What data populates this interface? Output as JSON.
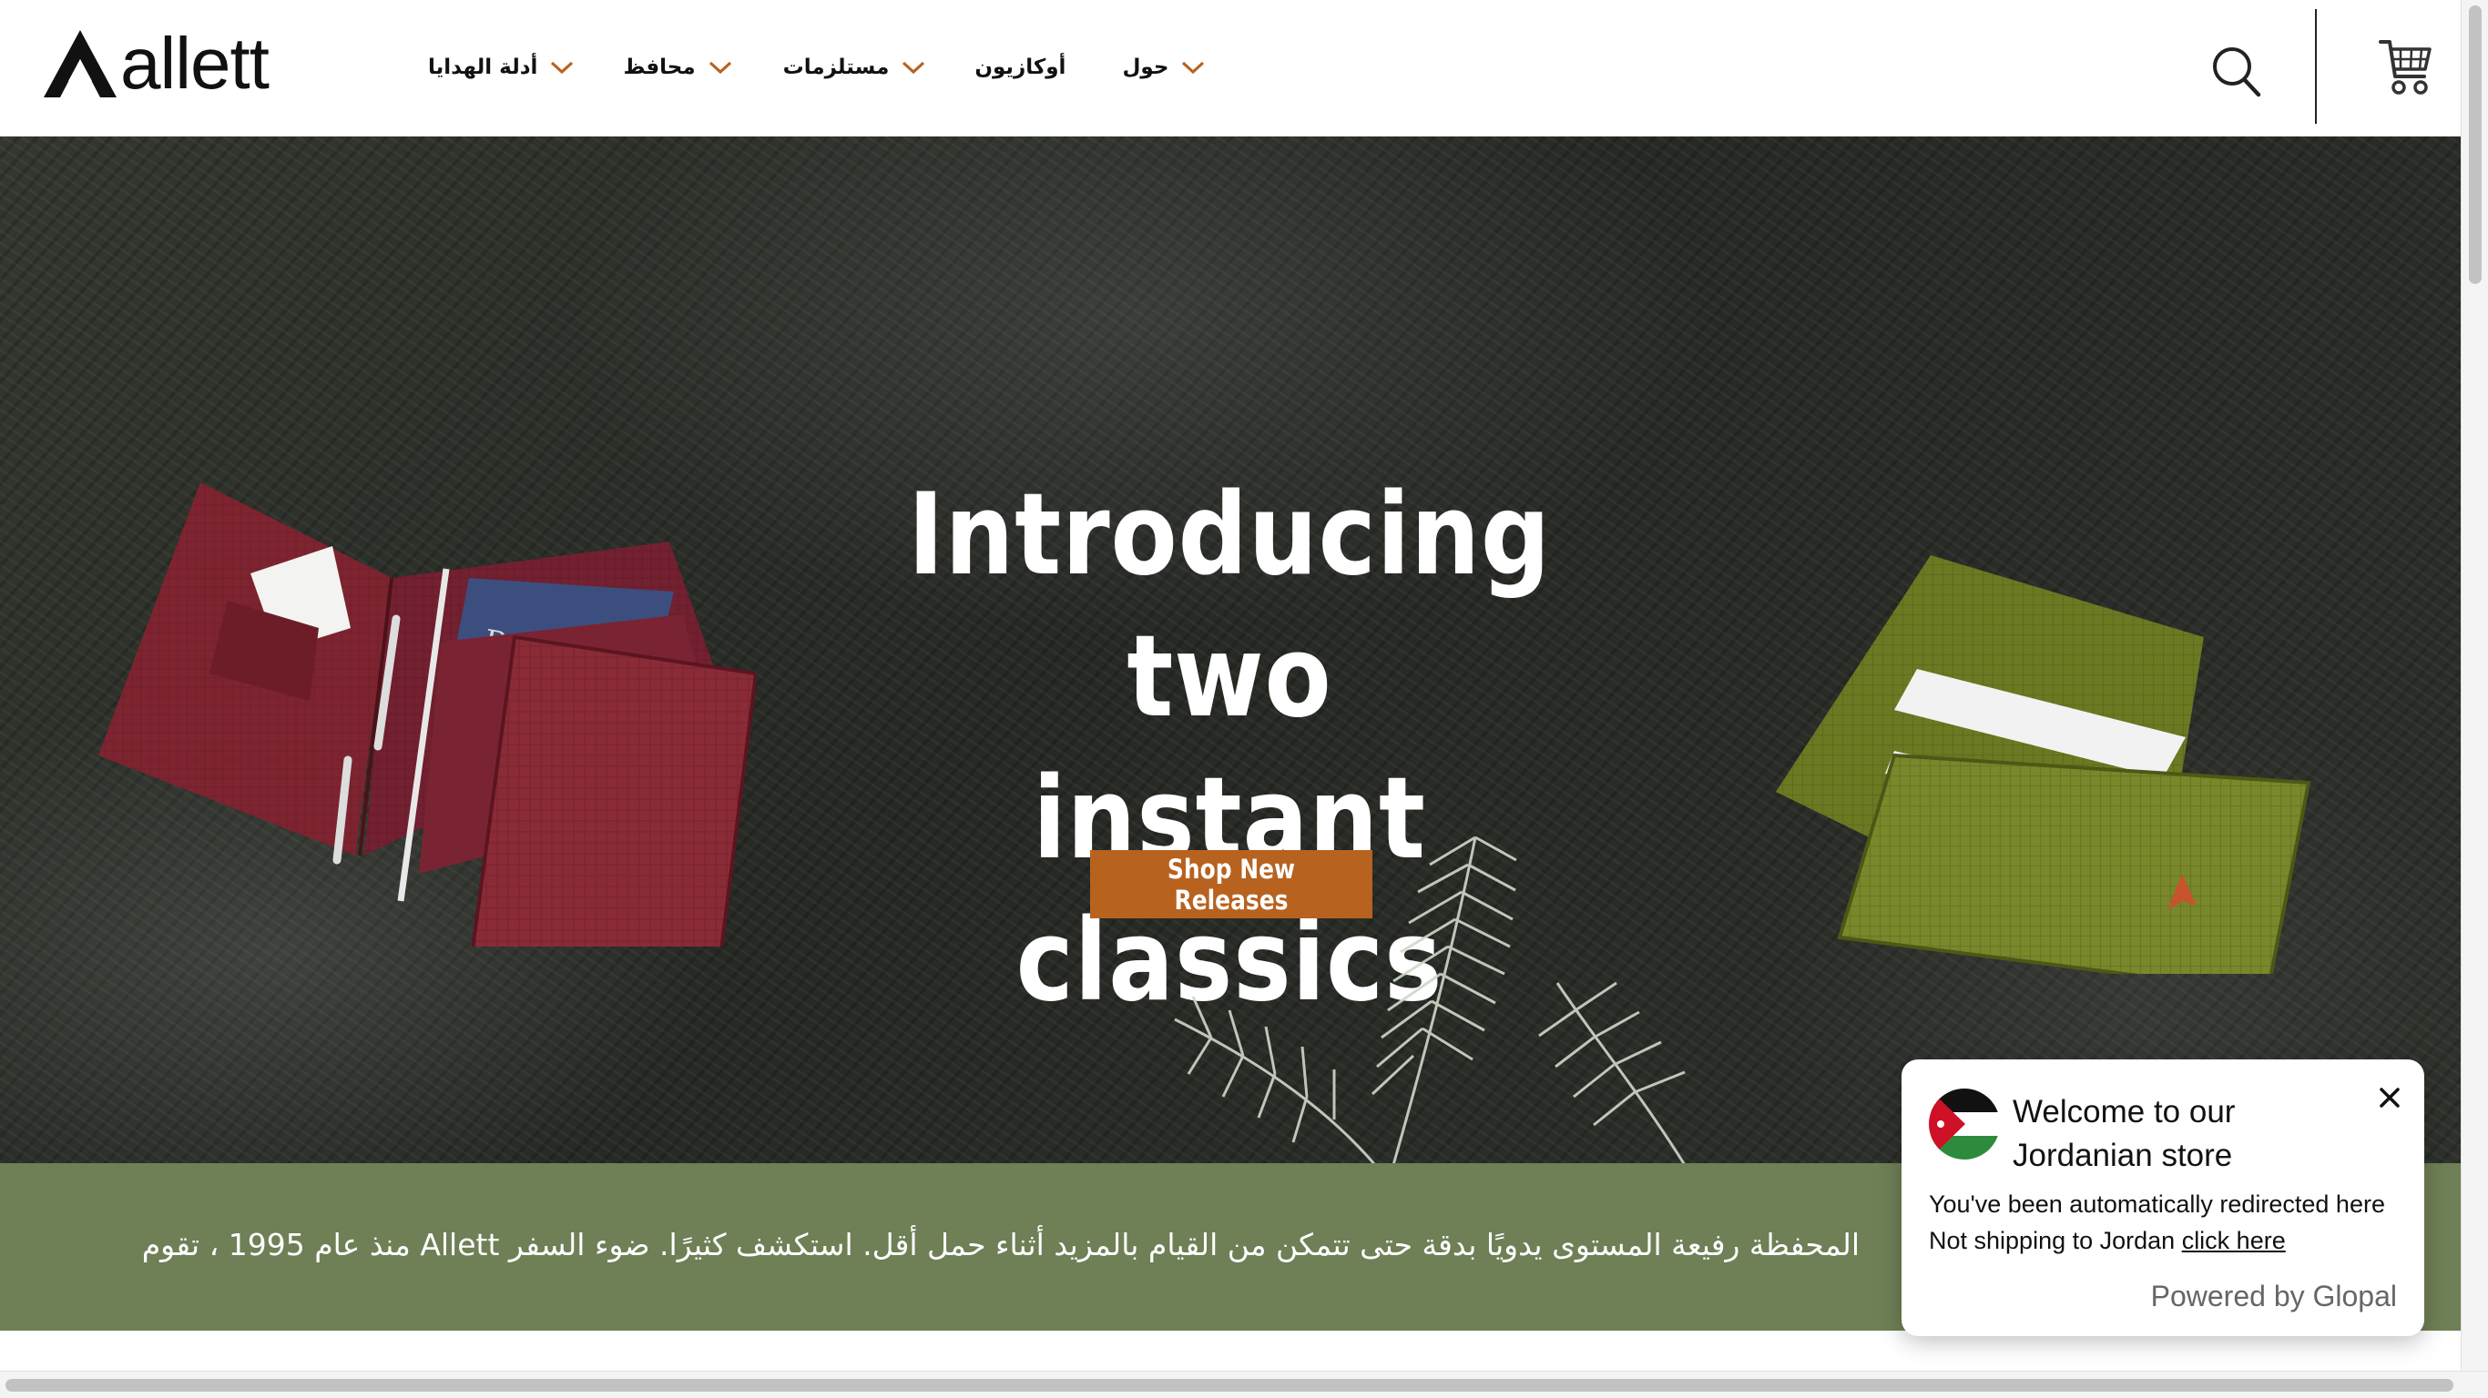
{
  "brand": {
    "logo_text": "allett"
  },
  "nav": {
    "items": [
      {
        "label": "أدلة الهدايا",
        "has_dropdown": true
      },
      {
        "label": "محافظ",
        "has_dropdown": true
      },
      {
        "label": "مستلزمات",
        "has_dropdown": true
      },
      {
        "label": "أوكازيون",
        "has_dropdown": false
      },
      {
        "label": "حول",
        "has_dropdown": true
      }
    ],
    "chevron_color": "#b8621f"
  },
  "header_icons": {
    "search": "search-icon",
    "cart": "cart-icon"
  },
  "hero": {
    "title_line1": "Introducing two",
    "title_line2": "instant classics",
    "cta_label": "Shop New Releases",
    "cta_color": "#b8621f"
  },
  "promo": {
    "text": "المحفظة رفيعة المستوى يدويًا بدقة حتى تتمكن من القيام بالمزيد أثناء حمل أقل. استكشف كثيرًا. ضوء السفر Allett منذ عام 1995 ، تقوم",
    "background": "#6f7f56"
  },
  "popup": {
    "title": "Welcome to our Jordanian store",
    "line1": "You've been automatically redirected here",
    "line2_prefix": "Not shipping to Jordan ",
    "line2_link": "click here",
    "powered_by": "Powered by Glopal",
    "close_icon": "close-icon",
    "flag_icon": "jordan-flag-icon"
  }
}
